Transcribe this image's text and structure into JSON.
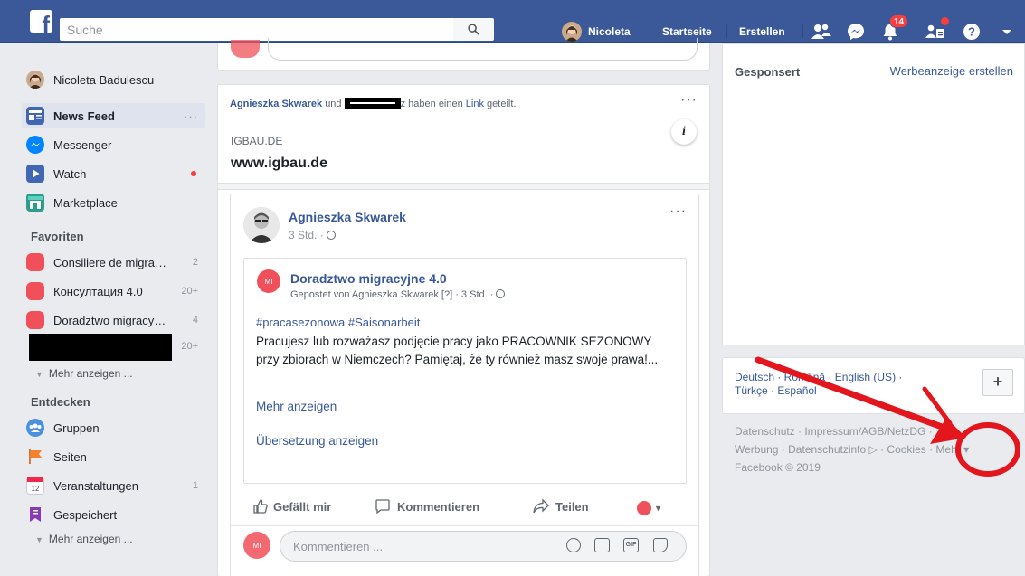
{
  "topbar": {
    "logo": "f",
    "search_placeholder": "Suche",
    "user_name": "Nicoleta",
    "home": "Startseite",
    "create": "Erstellen",
    "notifications_count": "14",
    "icons": [
      "friends-icon",
      "messenger-icon",
      "notifications-icon",
      "friend-requests-icon",
      "help-icon",
      "caret-down-icon"
    ]
  },
  "sidebar": {
    "profile_name": "Nicoleta Badulescu",
    "main": [
      {
        "label": "News Feed",
        "icon": "news-feed-icon",
        "color": "#4267b2"
      },
      {
        "label": "Messenger",
        "icon": "messenger-icon",
        "color": "#0084ff"
      },
      {
        "label": "Watch",
        "icon": "watch-icon",
        "color": "#4267b2"
      },
      {
        "label": "Marketplace",
        "icon": "marketplace-icon",
        "color": "#2a9d8f"
      }
    ],
    "favorites_title": "Favoriten",
    "favorites": [
      {
        "label": "Consiliere de migra…",
        "count": "2"
      },
      {
        "label": "Консултация 4.0",
        "count": "20+"
      },
      {
        "label": "Doradztwo migracy…",
        "count": "4"
      },
      {
        "label": "",
        "count": "20+"
      }
    ],
    "more1": "Mehr anzeigen ...",
    "explore_title": "Entdecken",
    "explore": [
      {
        "label": "Gruppen",
        "count": "",
        "icon": "groups-icon"
      },
      {
        "label": "Seiten",
        "count": "",
        "icon": "pages-icon"
      },
      {
        "label": "Veranstaltungen",
        "count": "1",
        "icon": "events-icon"
      },
      {
        "label": "Gespeichert",
        "count": "",
        "icon": "saved-icon"
      }
    ],
    "more2": "Mehr anzeigen ...",
    "events_icon_number": "12"
  },
  "feed": {
    "share_header": {
      "name": "Agnieszka Skwarek",
      "und": "und",
      "suffix_char": "z",
      "text1": "haben einen",
      "link_word": "Link",
      "text2": "geteilt."
    },
    "link_preview": {
      "domain": "IGBAU.DE",
      "title": "www.igbau.de"
    },
    "post": {
      "author": "Agnieszka Skwarek",
      "time": "3 Std. ·",
      "inner": {
        "page": "Doradztwo migracyjne 4.0",
        "posted_by": "Gepostet von Agnieszka Skwarek [?] · 3 Std. ·",
        "hashtags": "#pracasezonowa #Saisonarbeit",
        "body": "Pracujesz lub rozważasz podjęcie pracy jako PRACOWNIK SEZONOWY przy zbiorach w Niemczech? Pamiętaj, że ty również masz swoje prawa!...",
        "more": "Mehr anzeigen",
        "translate": "Übersetzung anzeigen"
      },
      "actions": {
        "like": "Gefällt mir",
        "comment": "Kommentieren",
        "share": "Teilen"
      },
      "comment_placeholder": "Kommentieren ...",
      "page_avatar_text": "MI"
    }
  },
  "right": {
    "sponsored": "Gesponsert",
    "create_ad": "Werbeanzeige erstellen",
    "languages_line1": "Deutsch · Română · English (US) ·",
    "languages_line2": "Türkçe · Español",
    "add_language": "+",
    "footer_line1": "Datenschutz · Impressum/AGB/NetzDG ·",
    "footer_line2": "Werbung · Datenschutzinfo ▷ · Cookies · Mehr ▾",
    "copyright": "Facebook © 2019"
  },
  "colors": {
    "brand": "#3b5998",
    "link": "#385898",
    "annotation": "#e3161d"
  }
}
